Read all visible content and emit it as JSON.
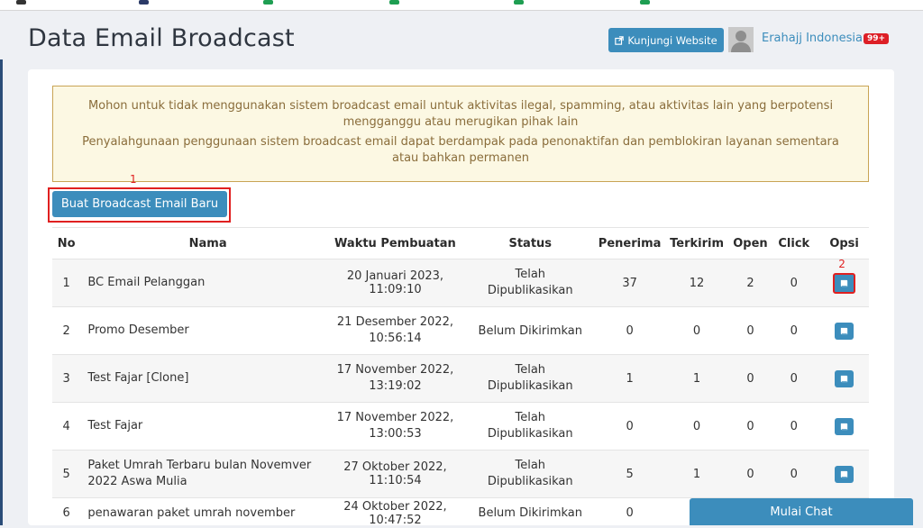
{
  "header": {
    "title": "Data Email Broadcast",
    "visit_website_label": "Kunjungi Website",
    "user_name": "Erahajj Indonesia",
    "notification_count": "99+"
  },
  "alert": {
    "line1": "Mohon untuk tidak menggunakan sistem broadcast email untuk aktivitas ilegal, spamming, atau aktivitas lain yang berpotensi mengganggu atau merugikan pihak lain",
    "line2": "Penyalahgunaan penggunaan sistem broadcast email dapat berdampak pada penonaktifan dan pemblokiran layanan sementara atau bahkan permanen"
  },
  "markers": {
    "m1": "1",
    "m2": "2"
  },
  "actions": {
    "new_broadcast_label": "Buat Broadcast Email Baru"
  },
  "table": {
    "headers": {
      "no": "No",
      "nama": "Nama",
      "waktu": "Waktu Pembuatan",
      "status": "Status",
      "penerima": "Penerima",
      "terkirim": "Terkirim",
      "open": "Open",
      "click": "Click",
      "opsi": "Opsi"
    },
    "rows": [
      {
        "no": "1",
        "nama": "BC Email Pelanggan",
        "waktu": "20 Januari 2023, 11:09:10",
        "status": "Telah Dipublikasikan",
        "penerima": "37",
        "terkirim": "12",
        "open": "2",
        "click": "0"
      },
      {
        "no": "2",
        "nama": "Promo Desember",
        "waktu": "21 Desember 2022, 10:56:14",
        "status": "Belum Dikirimkan",
        "penerima": "0",
        "terkirim": "0",
        "open": "0",
        "click": "0"
      },
      {
        "no": "3",
        "nama": "Test Fajar [Clone]",
        "waktu": "17 November 2022, 13:19:02",
        "status": "Telah Dipublikasikan",
        "penerima": "1",
        "terkirim": "1",
        "open": "0",
        "click": "0"
      },
      {
        "no": "4",
        "nama": "Test Fajar",
        "waktu": "17 November 2022, 13:00:53",
        "status": "Telah Dipublikasikan",
        "penerima": "0",
        "terkirim": "0",
        "open": "0",
        "click": "0"
      },
      {
        "no": "5",
        "nama": "Paket Umrah Terbaru bulan Novemver 2022 Aswa Mulia",
        "waktu": "27 Oktober 2022, 11:10:54",
        "status": "Telah Dipublikasikan",
        "penerima": "5",
        "terkirim": "1",
        "open": "0",
        "click": "0"
      },
      {
        "no": "6",
        "nama": "penawaran paket umrah november",
        "waktu": "24 Oktober 2022, 10:47:52",
        "status": "Belum Dikirimkan",
        "penerima": "0",
        "terkirim": "",
        "open": "",
        "click": ""
      }
    ]
  },
  "chat": {
    "label": "Mulai Chat"
  },
  "colors": {
    "primary": "#3c8dbc",
    "annotation": "#e02020",
    "alert_bg": "#fcf8e3",
    "alert_text": "#8a6d3b",
    "badge": "#dd1f26"
  },
  "icons": {
    "visit": "external-link-icon",
    "option": "book-icon",
    "avatar": "user-silhouette-icon"
  }
}
